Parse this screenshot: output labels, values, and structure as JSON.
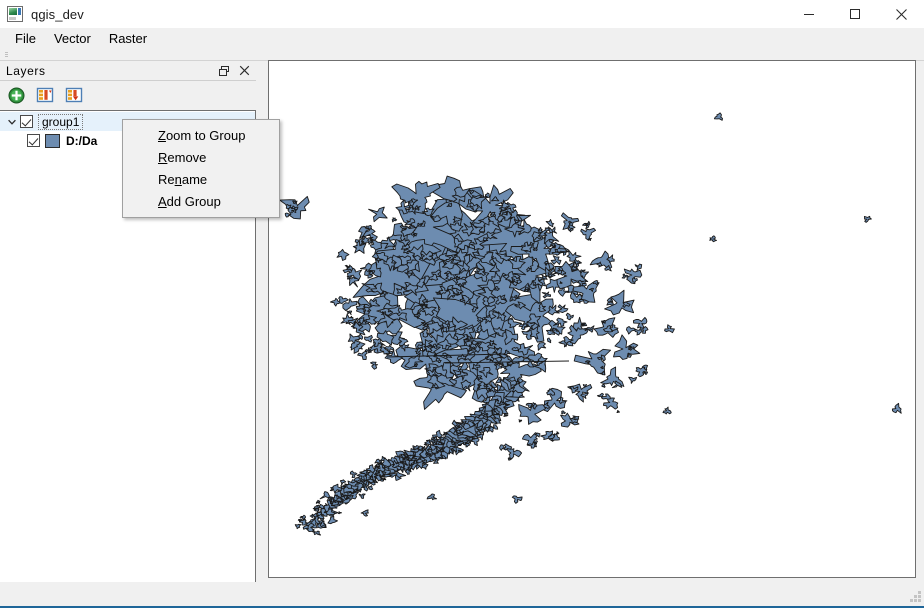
{
  "window": {
    "title": "qgis_dev",
    "icon": "app-window-icon",
    "minimize_label": "─",
    "maximize_label": "□",
    "close_label": "✕"
  },
  "menubar": {
    "items": [
      {
        "label": "File"
      },
      {
        "label": "Vector"
      },
      {
        "label": "Raster"
      }
    ]
  },
  "layers_panel": {
    "title": "Layers",
    "float_button": "float-panel-icon",
    "close_button": "close-panel-icon",
    "toolbar": [
      {
        "name": "add-group-button",
        "icon": "green-plus-icon"
      },
      {
        "name": "expand-all-button",
        "icon": "expand-all-icon"
      },
      {
        "name": "collapse-all-button",
        "icon": "collapse-all-icon"
      }
    ],
    "tree": {
      "group": {
        "label": "group1",
        "checked": true,
        "expanded": true,
        "expander_glyph": "⌄"
      },
      "layer": {
        "label": "D:/Da",
        "checked": true,
        "symbol_color": "#6d8cb0"
      }
    }
  },
  "context_menu": {
    "items": [
      {
        "label": "Zoom to Group",
        "underline_index": 0,
        "name": "zoom-to-group"
      },
      {
        "label": "Remove",
        "underline_index": 0,
        "name": "remove"
      },
      {
        "label": "Rename",
        "underline_index": 2,
        "name": "rename"
      },
      {
        "label": "Add Group",
        "underline_index": 0,
        "name": "add-group"
      }
    ]
  },
  "map": {
    "background": "#ffffff",
    "polygon_fill": "#6d8cb0",
    "polygon_stroke": "#1a1a1a"
  },
  "statusbar": {
    "text": ""
  }
}
